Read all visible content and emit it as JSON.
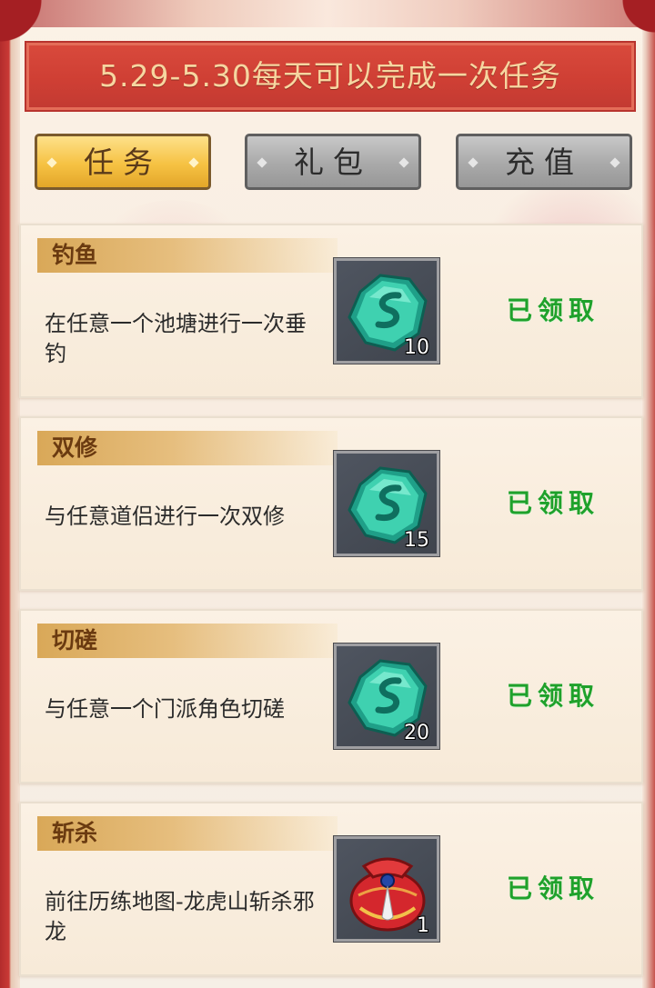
{
  "banner": {
    "text": "5.29-5.30每天可以完成一次任务"
  },
  "tabs": [
    {
      "label": "任务",
      "active": true
    },
    {
      "label": "礼包",
      "active": false
    },
    {
      "label": "充值",
      "active": false
    }
  ],
  "tasks": [
    {
      "title": "钓鱼",
      "desc": "在任意一个池塘进行一次垂钓",
      "reward_icon": "jade-stone-icon",
      "reward_count": "10",
      "status": "已领取"
    },
    {
      "title": "双修",
      "desc": "与任意道侣进行一次双修",
      "reward_icon": "jade-stone-icon",
      "reward_count": "15",
      "status": "已领取"
    },
    {
      "title": "切磋",
      "desc": "与任意一个门派角色切磋",
      "reward_icon": "jade-stone-icon",
      "reward_count": "20",
      "status": "已领取"
    },
    {
      "title": "斩杀",
      "desc": "前往历练地图-龙虎山斩杀邪龙",
      "reward_icon": "red-pouch-icon",
      "reward_count": "1",
      "status": "已领取"
    }
  ],
  "colors": {
    "banner_bg": "#cf3f34",
    "banner_text": "#f6d6a0",
    "tab_active": "#f6c243",
    "tab_inactive": "#a9a9a9",
    "claimed_text": "#1fa12b",
    "title_text": "#6a3a10"
  }
}
